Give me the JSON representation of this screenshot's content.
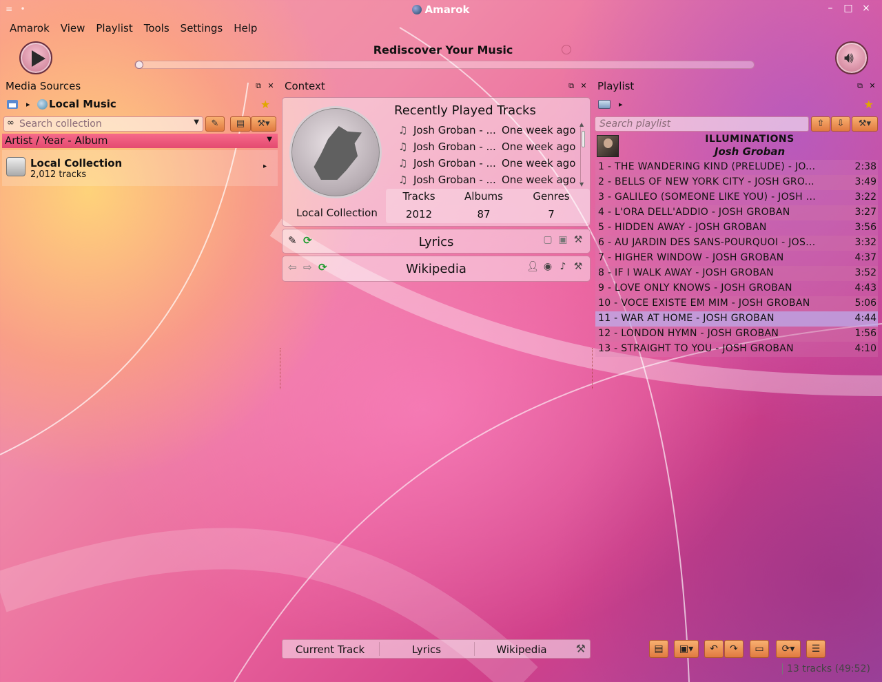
{
  "window": {
    "title": "Amarok",
    "controls": [
      "–",
      "□",
      "×"
    ]
  },
  "menu": [
    "Amarok",
    "View",
    "Playlist",
    "Tools",
    "Settings",
    "Help"
  ],
  "toolbar": {
    "now_playing": "Rediscover Your Music",
    "progress": 0
  },
  "media_sources": {
    "title": "Media Sources",
    "breadcrumb": "Local Music",
    "search_placeholder": "Search collection",
    "grouping": "Artist / Year - Album",
    "collection": {
      "name": "Local Collection",
      "count": "2,012 tracks"
    }
  },
  "context": {
    "title": "Context",
    "recently_played": {
      "title": "Recently Played Tracks",
      "rows": [
        {
          "track": "Josh Groban - ...",
          "when": "One week ago"
        },
        {
          "track": "Josh Groban - ...",
          "when": "One week ago"
        },
        {
          "track": "Josh Groban - ...",
          "when": "One week ago"
        },
        {
          "track": "Josh Groban - ...",
          "when": "One week ago"
        }
      ],
      "collection_label": "Local Collection",
      "stats": [
        {
          "label": "Tracks",
          "value": "2012"
        },
        {
          "label": "Albums",
          "value": "87"
        },
        {
          "label": "Genres",
          "value": "7"
        }
      ]
    },
    "lyrics_title": "Lyrics",
    "wikipedia_title": "Wikipedia",
    "tabs": [
      "Current Track",
      "Lyrics",
      "Wikipedia"
    ]
  },
  "playlist": {
    "title": "Playlist",
    "search_placeholder": "Search playlist",
    "album": "ILLUMINATIONS",
    "artist": "Josh Groban",
    "active_index": 10,
    "tracks": [
      {
        "title": "1 - THE WANDERING KIND (PRELUDE) - JO...",
        "duration": "2:38"
      },
      {
        "title": "2 - BELLS OF NEW YORK CITY - JOSH GRO...",
        "duration": "3:49"
      },
      {
        "title": "3 - GALILEO (SOMEONE LIKE YOU) - JOSH ...",
        "duration": "3:22"
      },
      {
        "title": "4 - L'ORA DELL'ADDIO - JOSH GROBAN",
        "duration": "3:27"
      },
      {
        "title": "5 - HIDDEN AWAY - JOSH GROBAN",
        "duration": "3:56"
      },
      {
        "title": "6 - AU JARDIN DES SANS-POURQUOI - JOS...",
        "duration": "3:32"
      },
      {
        "title": "7 - HIGHER WINDOW - JOSH GROBAN",
        "duration": "4:37"
      },
      {
        "title": "8 - IF I WALK AWAY - JOSH GROBAN",
        "duration": "3:52"
      },
      {
        "title": "9 - LOVE ONLY KNOWS - JOSH GROBAN",
        "duration": "4:43"
      },
      {
        "title": "10 - VOCE EXISTE EM MIM - JOSH GROBAN",
        "duration": "5:06"
      },
      {
        "title": "11 - WAR AT HOME - JOSH GROBAN",
        "duration": "4:44"
      },
      {
        "title": "12 - LONDON HYMN - JOSH GROBAN",
        "duration": "1:56"
      },
      {
        "title": "13 - STRAIGHT TO YOU - JOSH GROBAN",
        "duration": "4:10"
      }
    ],
    "status": "13 tracks (49:52)"
  }
}
